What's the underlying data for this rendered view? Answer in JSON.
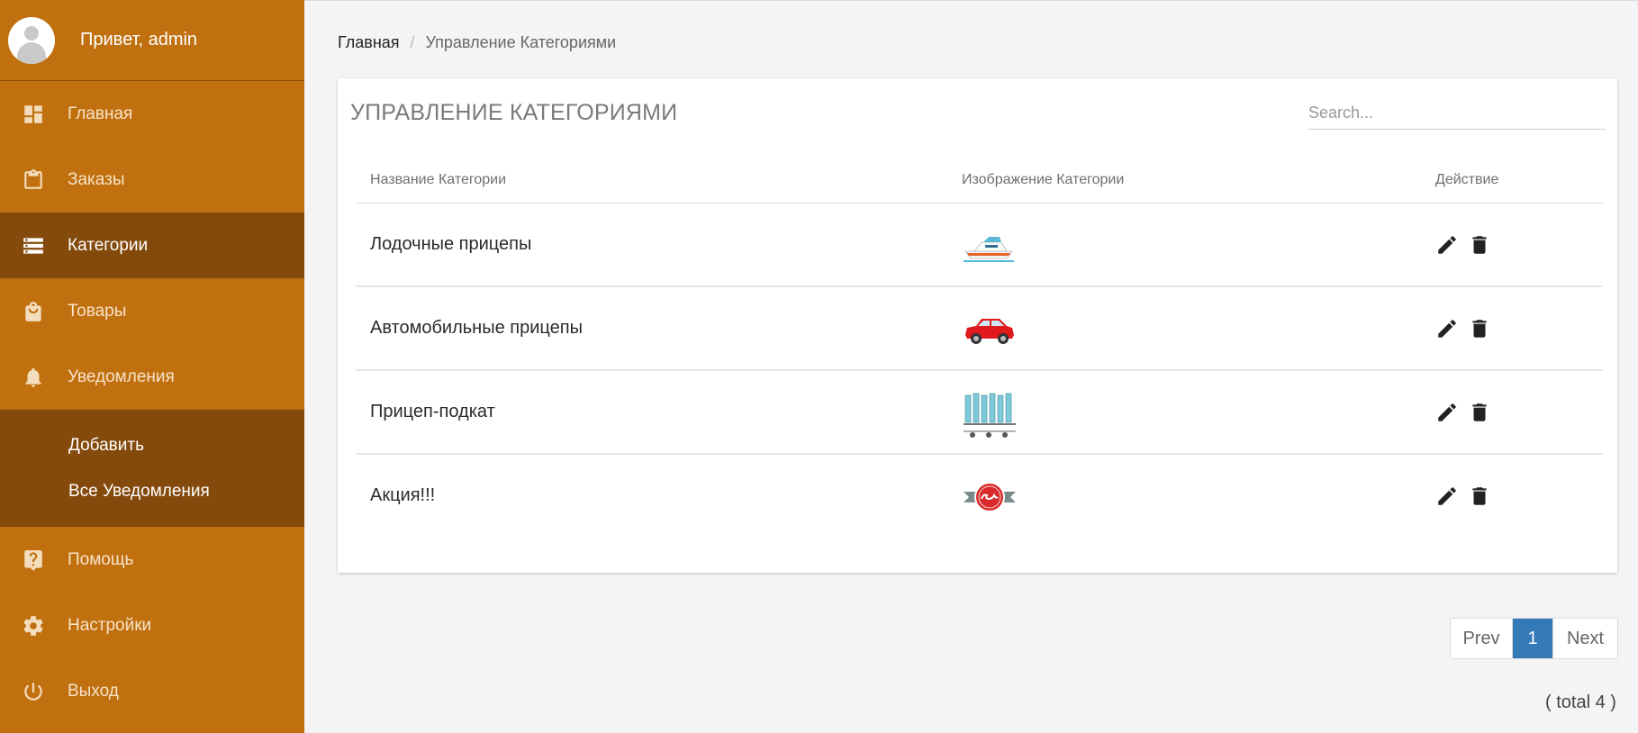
{
  "sidebar": {
    "greeting": "Привет, admin",
    "items": [
      {
        "label": "Главная",
        "icon": "dashboard-icon"
      },
      {
        "label": "Заказы",
        "icon": "clipboard-icon"
      },
      {
        "label": "Категории",
        "icon": "storage-icon"
      },
      {
        "label": "Товары",
        "icon": "shopping-bag-icon"
      },
      {
        "label": "Уведомления",
        "icon": "bell-icon"
      }
    ],
    "submenu": [
      {
        "label": "Добавить"
      },
      {
        "label": "Все Уведомления"
      }
    ],
    "bottom_items": [
      {
        "label": "Помощь",
        "icon": "help-icon"
      },
      {
        "label": "Настройки",
        "icon": "gear-icon"
      },
      {
        "label": "Выход",
        "icon": "power-icon"
      }
    ],
    "active_color": "#844a0c",
    "bg_color": "#c0700f"
  },
  "breadcrumb": {
    "home": "Главная",
    "separator": "/",
    "current": "Управление Категориями"
  },
  "card": {
    "title": "УПРАВЛЕНИЕ КАТЕГОРИЯМИ",
    "search_placeholder": "Search...",
    "columns": [
      "Название Категории",
      "Изображение Категории",
      "Действие"
    ],
    "rows": [
      {
        "name": "Лодочные прицепы",
        "image": "boat-image"
      },
      {
        "name": "Автомобильные прицепы",
        "image": "car-image"
      },
      {
        "name": "Прицеп-подкат",
        "image": "trailer-image"
      },
      {
        "name": "Акция!!!",
        "image": "sale-badge-image"
      }
    ]
  },
  "pagination": {
    "prev": "Prev",
    "current": "1",
    "next": "Next",
    "total": "( total 4 )",
    "accent": "#337ab7"
  }
}
